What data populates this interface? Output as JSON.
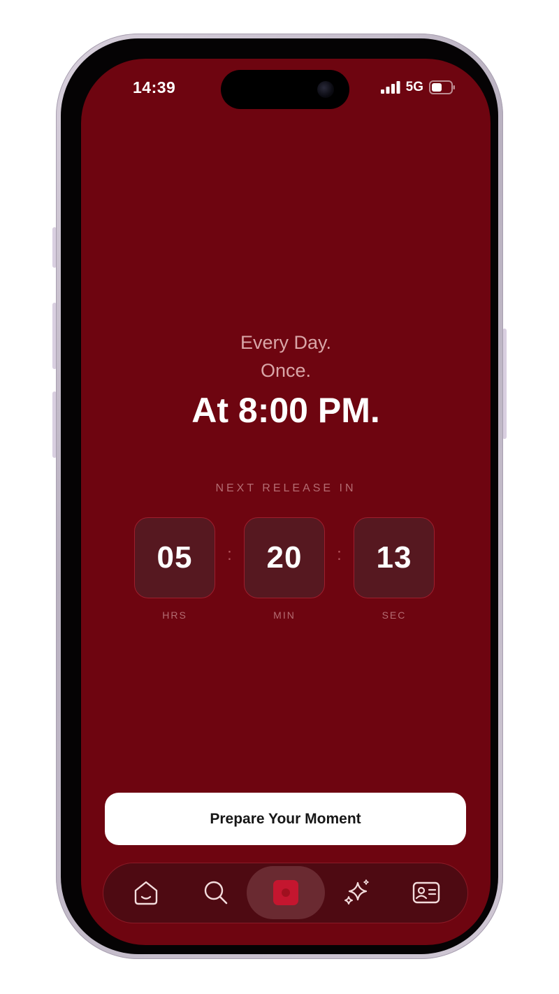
{
  "status_bar": {
    "time": "14:39",
    "network": "5G",
    "icons": [
      "signal-icon",
      "battery-icon"
    ]
  },
  "headline": {
    "line1": "Every Day.",
    "line2": "Once.",
    "line3": "At 8:00 PM."
  },
  "countdown": {
    "label": "NEXT RELEASE IN",
    "hours": "05",
    "minutes": "20",
    "seconds": "13",
    "separator": ":",
    "hours_unit": "HRS",
    "minutes_unit": "MIN",
    "seconds_unit": "SEC"
  },
  "cta": {
    "label": "Prepare Your Moment"
  },
  "tab_bar": {
    "items": [
      {
        "id": "home",
        "icon": "home-icon"
      },
      {
        "id": "search",
        "icon": "search-icon"
      },
      {
        "id": "capture",
        "icon": "capture-icon",
        "active": true
      },
      {
        "id": "discover",
        "icon": "sparkle-icon"
      },
      {
        "id": "profile",
        "icon": "profile-card-icon"
      }
    ]
  },
  "colors": {
    "screen_background": "#6e0510",
    "countdown_box": "#561820",
    "accent": "#c4162f",
    "soft_text": "#d9a6a8",
    "cta_background": "#ffffff",
    "cta_text": "#161616"
  }
}
